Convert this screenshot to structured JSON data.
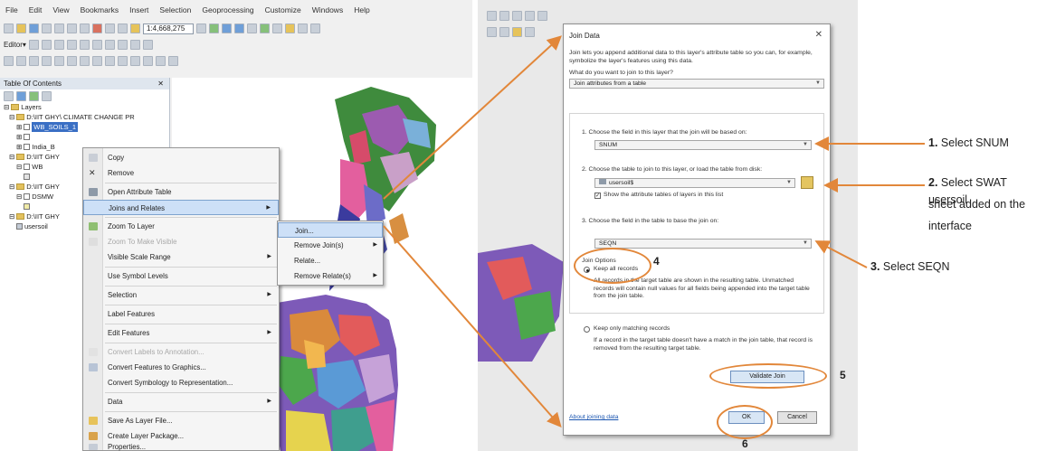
{
  "menu": [
    "File",
    "Edit",
    "View",
    "Bookmarks",
    "Insert",
    "Selection",
    "Geoprocessing",
    "Customize",
    "Windows",
    "Help"
  ],
  "toolbar": {
    "scale": "1:4,668,275",
    "editor_label": "Editor▾"
  },
  "toc": {
    "title": "Table Of Contents",
    "layers_label": "Layers",
    "rows": [
      "D:\\IIT GHY\\ CLIMATE CHANGE PR",
      "WB_SOILS_1",
      "",
      "India_B",
      "D:\\IIT GHY",
      "WB",
      "",
      "D:\\IIT GHY",
      "DSMW",
      "",
      "D:\\IIT GHY",
      "usersoil"
    ]
  },
  "context_menu": {
    "items": [
      "Copy",
      "Remove",
      "Open Attribute Table",
      "Joins and Relates",
      "Zoom To Layer",
      "Zoom To Make Visible",
      "Visible Scale Range",
      "Use Symbol Levels",
      "Selection",
      "Label Features",
      "Edit Features",
      "Convert Labels to Annotation...",
      "Convert Features to Graphics...",
      "Convert Symbology to Representation...",
      "Data",
      "Save As Layer File...",
      "Create Layer Package...",
      "Properties..."
    ]
  },
  "submenu": {
    "items": [
      "Join...",
      "Remove Join(s)",
      "Relate...",
      "Remove Relate(s)"
    ]
  },
  "dialog": {
    "title": "Join Data",
    "intro": "Join lets you append additional data to this layer's attribute table so you can, for example, symbolize the layer's features using this data.",
    "question": "What do you want to join to this layer?",
    "join_type": "Join attributes from a table",
    "step1": "1.  Choose the field in this layer that the join will be based on:",
    "field1": "SNUM",
    "step2": "2.  Choose the table to join to this layer, or load the table from disk:",
    "table2": "usersoil$",
    "show_attr": "Show the attribute tables of layers in this list",
    "step3": "3.  Choose the field in the table to base the join on:",
    "field3": "SEQN",
    "join_options": "Join Options",
    "keep_all": "Keep all records",
    "keep_all_desc": "All records in the target table are shown in the resulting table. Unmatched records will contain null values for all fields being appended into the target table from the join table.",
    "keep_match": "Keep only matching records",
    "keep_match_desc": "If a record in the target table doesn't have a match in the join table, that record is removed from the resulting target table.",
    "validate": "Validate Join",
    "about": "About joining data",
    "ok": "OK",
    "cancel": "Cancel"
  },
  "annotations": {
    "a1_num": "1.",
    "a1_text": "Select SNUM",
    "a2_num": "2.",
    "a2_text_1": "Select SWAT usersoil",
    "a2_text_2": "sheet added on the",
    "a2_text_3": "interface",
    "a3_num": "3.",
    "a3_text": "Select SEQN",
    "n4": "4",
    "n5": "5",
    "n6": "6"
  },
  "colors": {
    "annotation": "#e2873a",
    "highlight": "#cde0f7"
  }
}
